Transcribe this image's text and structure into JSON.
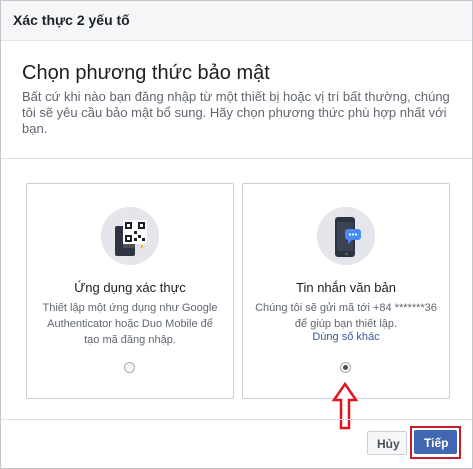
{
  "dialog": {
    "title": "Xác thực 2 yếu tố"
  },
  "intro": {
    "heading": "Chọn phương thức bảo mật",
    "description": "Bất cứ khi nào bạn đăng nhập từ một thiết bị hoặc vị trí bất thường, chúng tôi sẽ yêu cầu bảo mật bổ sung. Hãy chọn phương thức phù hợp nhất với bạn."
  },
  "options": [
    {
      "icon": "qr-code-icon",
      "title": "Ứng dụng xác thực",
      "description": "Thiết lập một ứng dụng như Google Authenticator hoặc Duo Mobile để tạo mã đăng nhập.",
      "selected": false
    },
    {
      "icon": "phone-sms-icon",
      "title": "Tin nhắn văn bản",
      "description": "Chúng tôi sẽ gửi mã tới +84 *******36 để giúp bạn thiết lập.",
      "link": "Dùng số khác",
      "selected": true
    }
  ],
  "footer": {
    "cancel_label": "Hủy",
    "next_label": "Tiếp"
  },
  "colors": {
    "primary": "#4267b2",
    "highlight": "#c41e2e",
    "link": "#385898"
  }
}
